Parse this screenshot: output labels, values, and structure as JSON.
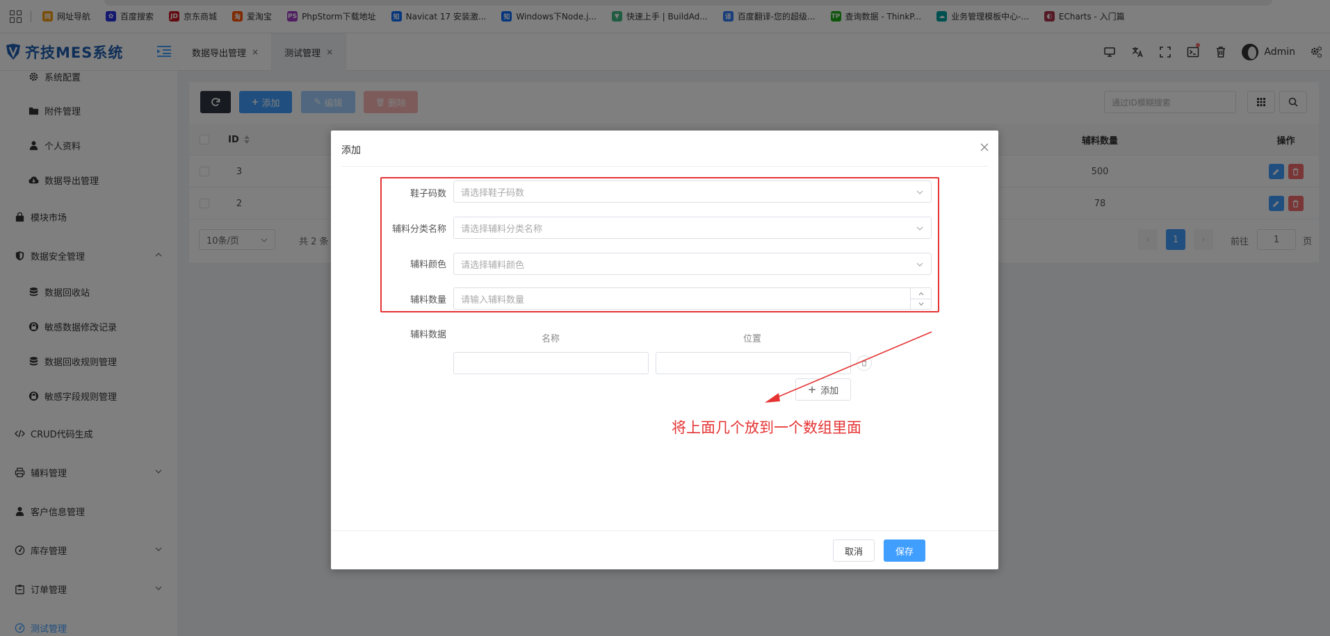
{
  "colors": {
    "primary": "#409eff",
    "brand": "#1f5fb0",
    "danger": "#f56c6c",
    "dark_button": "#2f3440",
    "annotation_red": "#e53333"
  },
  "bookmarks": [
    {
      "label": "网址导航",
      "icon": "nav-icon",
      "color": "#f39c12",
      "glyph": "网"
    },
    {
      "label": "百度搜索",
      "icon": "baidu-paw-icon",
      "color": "#2932e1",
      "glyph": "✿"
    },
    {
      "label": "京东商城",
      "icon": "jd-icon",
      "color": "#c81623",
      "glyph": "JD"
    },
    {
      "label": "爱淘宝",
      "icon": "taobao-icon",
      "color": "#ff5000",
      "glyph": "淘"
    },
    {
      "label": "PhpStorm下载地址",
      "icon": "phpstorm-icon",
      "color": "#a13cc4",
      "glyph": "PS"
    },
    {
      "label": "Navicat 17 安装激...",
      "icon": "zhihu-icon",
      "color": "#0d6efd",
      "glyph": "知"
    },
    {
      "label": "Windows下Node.j...",
      "icon": "zhihu-icon",
      "color": "#0d6efd",
      "glyph": "知"
    },
    {
      "label": "快速上手 | BuildAd...",
      "icon": "vue-icon",
      "color": "#41b883",
      "glyph": "▼"
    },
    {
      "label": "百度翻译-您的超级...",
      "icon": "translate-icon",
      "color": "#2e7bf6",
      "glyph": "译"
    },
    {
      "label": "查询数据 - ThinkP...",
      "icon": "thinkphp-icon",
      "color": "#1aad19",
      "glyph": "TP"
    },
    {
      "label": "业务管理模板中心-...",
      "icon": "cloud-icon",
      "color": "#00a0a0",
      "glyph": "☁"
    },
    {
      "label": "ECharts - 入门篇",
      "icon": "echarts-icon",
      "color": "#aa344d",
      "glyph": "◐"
    }
  ],
  "header": {
    "logo": "齐技MES系统",
    "tabs": [
      {
        "label": "数据导出管理",
        "close": "×"
      },
      {
        "label": "测试管理",
        "close": "×"
      }
    ],
    "user": "Admin"
  },
  "sidebar": {
    "items": [
      {
        "label": "系统配置",
        "icon": "gear-icon"
      },
      {
        "label": "附件管理",
        "icon": "folder-icon"
      },
      {
        "label": "个人资料",
        "icon": "user-icon"
      },
      {
        "label": "数据导出管理",
        "icon": "cloud-download-icon"
      },
      {
        "label": "模块市场",
        "icon": "shop-icon"
      },
      {
        "label": "数据安全管理",
        "icon": "shield-icon"
      },
      {
        "label": "数据回收站",
        "icon": "database-icon"
      },
      {
        "label": "敏感数据修改记录",
        "icon": "lock-icon"
      },
      {
        "label": "数据回收规则管理",
        "icon": "database-icon"
      },
      {
        "label": "敏感字段规则管理",
        "icon": "lock-icon"
      },
      {
        "label": "CRUD代码生成",
        "icon": "code-icon"
      },
      {
        "label": "辅料管理",
        "icon": "printer-icon"
      },
      {
        "label": "客户信息管理",
        "icon": "user-icon"
      },
      {
        "label": "库存管理",
        "icon": "gauge-icon"
      },
      {
        "label": "订单管理",
        "icon": "clipboard-icon"
      },
      {
        "label": "测试管理",
        "icon": "gauge-icon"
      }
    ]
  },
  "toolbar": {
    "add": "添加",
    "edit": "编辑",
    "delete": "删除",
    "search_placeholder": "通过ID模糊搜索"
  },
  "table": {
    "headers": {
      "id": "ID",
      "qty": "辅料数量",
      "ops": "操作"
    },
    "rows": [
      {
        "id": "3",
        "qty": "500"
      },
      {
        "id": "2",
        "qty": "78"
      }
    ]
  },
  "pager": {
    "size": "10条/页",
    "total": "共 2 条",
    "current": "1",
    "goto_label": "前往",
    "goto_value": "1",
    "page_suffix": "页"
  },
  "dialog": {
    "title": "添加",
    "fields": [
      {
        "label": "鞋子码数",
        "placeholder": "请选择鞋子码数"
      },
      {
        "label": "辅料分类名称",
        "placeholder": "请选择辅料分类名称"
      },
      {
        "label": "辅料颜色",
        "placeholder": "请选择辅料颜色"
      },
      {
        "label": "辅料数量",
        "placeholder": "请输入辅料数量"
      }
    ],
    "data_label": "辅料数据",
    "col_name": "名称",
    "col_position": "位置",
    "add_row": "添加",
    "annotation": "将上面几个放到一个数组里面",
    "cancel": "取消",
    "save": "保存"
  }
}
